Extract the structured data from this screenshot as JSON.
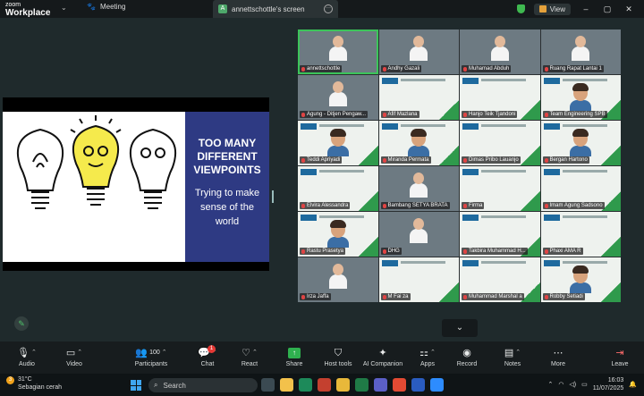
{
  "titlebar": {
    "app_zoom": "zoom",
    "app_name": "Workplace",
    "meeting_label": "Meeting",
    "share_tab_label": "annettschottle's screen",
    "share_tab_avatar": "A",
    "view_label": "View"
  },
  "slide": {
    "title": "TOO MANY DIFFERENT VIEWPOINTS",
    "subtitle": "Trying to make sense of the world"
  },
  "gallery": [
    {
      "name": "annettschottle",
      "kind": "photo",
      "active": true
    },
    {
      "name": "Andhy Gazali",
      "kind": "photo",
      "active": false
    },
    {
      "name": "Muhamad Abduh",
      "kind": "photo",
      "active": false
    },
    {
      "name": "Ruang Rapat Lantai 1",
      "kind": "photo",
      "active": false
    },
    {
      "name": "Agung - Ditjen Pengaw...",
      "kind": "photo",
      "active": false
    },
    {
      "name": "Afif Mazlana",
      "kind": "slide",
      "active": false
    },
    {
      "name": "Hanjo Teik Tjandoni",
      "kind": "slide",
      "active": false
    },
    {
      "name": "Team Engineering SPB",
      "kind": "avatar",
      "active": false
    },
    {
      "name": "Teddi Apriyadi",
      "kind": "avatar",
      "active": false
    },
    {
      "name": "Miranda Permata",
      "kind": "avatar",
      "active": false
    },
    {
      "name": "Dimas Pribo Lauanjo",
      "kind": "slide",
      "active": false
    },
    {
      "name": "Bergan Hartono",
      "kind": "avatar",
      "active": false
    },
    {
      "name": "Elvira Alessandra",
      "kind": "slide",
      "active": false
    },
    {
      "name": "Bambang SETYA BRATA",
      "kind": "photo",
      "active": false
    },
    {
      "name": "Firma",
      "kind": "slide",
      "active": false
    },
    {
      "name": "Imam Agung Sadsono",
      "kind": "slide",
      "active": false
    },
    {
      "name": "Rastu Prasetya",
      "kind": "avatar",
      "active": false
    },
    {
      "name": "DHG",
      "kind": "photo",
      "active": false
    },
    {
      "name": "Takbira Muhammad H...",
      "kind": "slide",
      "active": false
    },
    {
      "name": "Phaxi AMA R",
      "kind": "slide",
      "active": false
    },
    {
      "name": "Irza Jaffa",
      "kind": "photo",
      "active": false
    },
    {
      "name": "M Fai za",
      "kind": "slide",
      "active": false
    },
    {
      "name": "Muhammad Marshal a",
      "kind": "slide",
      "active": false
    },
    {
      "name": "Robby Setiadi",
      "kind": "avatar",
      "active": false
    }
  ],
  "toolbar": {
    "audio": "Audio",
    "video": "Video",
    "participants": "Participants",
    "participants_count": "100",
    "chat": "Chat",
    "chat_badge": "1",
    "react": "React",
    "share": "Share",
    "host_tools": "Host tools",
    "ai_companion": "AI Companion",
    "apps": "Apps",
    "record": "Record",
    "notes": "Notes",
    "more": "More",
    "leave": "Leave"
  },
  "taskbar": {
    "weather_temp": "31°C",
    "weather_desc": "Sebagian cerah",
    "weather_badge": "3",
    "search_placeholder": "Search",
    "time": "16:03",
    "date": "11/07/2025"
  },
  "colors": {
    "accent_green": "#3cc45a",
    "slide_panel": "#2e3a83",
    "leave_red": "#ff6b6b"
  }
}
